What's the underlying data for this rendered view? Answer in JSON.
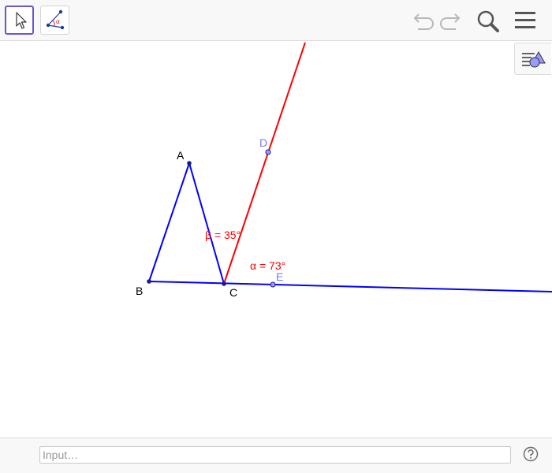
{
  "toolbar": {
    "tools": [
      {
        "icon": "move-arrow-icon"
      },
      {
        "icon": "angle-tool-icon",
        "glyph": "α"
      }
    ],
    "actions": [
      "undo-icon",
      "redo-icon",
      "search-icon",
      "menu-icon"
    ]
  },
  "construction": {
    "points": {
      "A": {
        "label": "A"
      },
      "B": {
        "label": "B"
      },
      "C": {
        "label": "C"
      },
      "D": {
        "label": "D"
      },
      "E": {
        "label": "E"
      }
    },
    "angles": {
      "beta": "β = 35°",
      "alpha": "α = 73°"
    }
  },
  "style_bar": {
    "icon": "style-bar-toggle-icon"
  },
  "input_bar": {
    "placeholder": "Input…",
    "help_icon": "help-icon"
  },
  "colors": {
    "triangle": "#0000ff",
    "ray": "#ff0000",
    "angle_label": "#ff0000",
    "aux_point_label": "#7878ff",
    "tool_selected_border": "#6557d2"
  }
}
